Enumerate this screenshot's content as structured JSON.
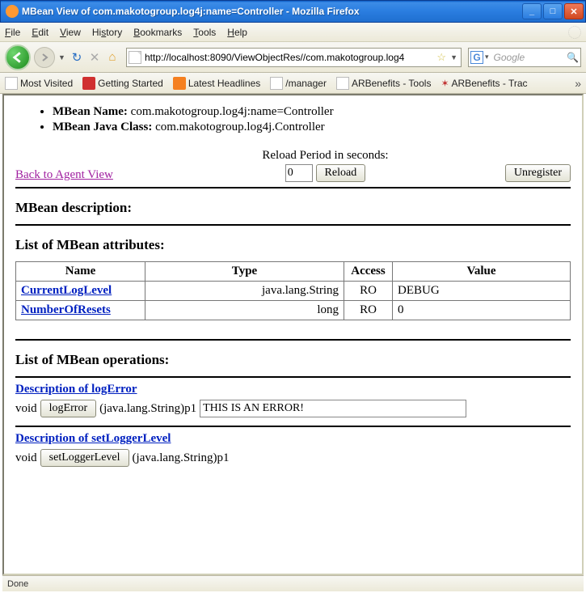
{
  "window": {
    "title": "MBean View of com.makotogroup.log4j:name=Controller - Mozilla Firefox"
  },
  "menu": {
    "file": "File",
    "edit": "Edit",
    "view": "View",
    "history": "History",
    "bookmarks": "Bookmarks",
    "tools": "Tools",
    "help": "Help"
  },
  "nav": {
    "url": "http://localhost:8090/ViewObjectRes//com.makotogroup.log4",
    "search_placeholder": "Google"
  },
  "bookmarks": {
    "most": "Most Visited",
    "gs": "Getting Started",
    "lh": "Latest Headlines",
    "mgr": "/manager",
    "arbt": "ARBenefits - Tools",
    "arbr": "ARBenefits - Trac"
  },
  "mbean": {
    "name_label": "MBean Name:",
    "name_value": "com.makotogroup.log4j:name=Controller",
    "class_label": "MBean Java Class:",
    "class_value": "com.makotogroup.log4j.Controller"
  },
  "links": {
    "back_agent": "Back to Agent View"
  },
  "reload": {
    "label": "Reload Period in seconds:",
    "value": "0",
    "btn": "Reload"
  },
  "unregister": {
    "btn": "Unregister"
  },
  "desc": {
    "heading": "MBean description:"
  },
  "attrs": {
    "heading": "List of MBean attributes:",
    "th_name": "Name",
    "th_type": "Type",
    "th_access": "Access",
    "th_value": "Value",
    "rows": [
      {
        "name": "CurrentLogLevel",
        "type": "java.lang.String",
        "access": "RO",
        "value": "DEBUG"
      },
      {
        "name": "NumberOfResets",
        "type": "long",
        "access": "RO",
        "value": "0"
      }
    ]
  },
  "ops": {
    "heading": "List of MBean operations:",
    "op1": {
      "desc": "Description of logError",
      "ret": "void",
      "btn": "logError",
      "param": "(java.lang.String)p1",
      "input": "THIS IS AN ERROR!"
    },
    "op2": {
      "desc": "Description of setLoggerLevel",
      "ret": "void",
      "btn": "setLoggerLevel",
      "param": "(java.lang.String)p1"
    }
  },
  "status": {
    "text": "Done"
  }
}
